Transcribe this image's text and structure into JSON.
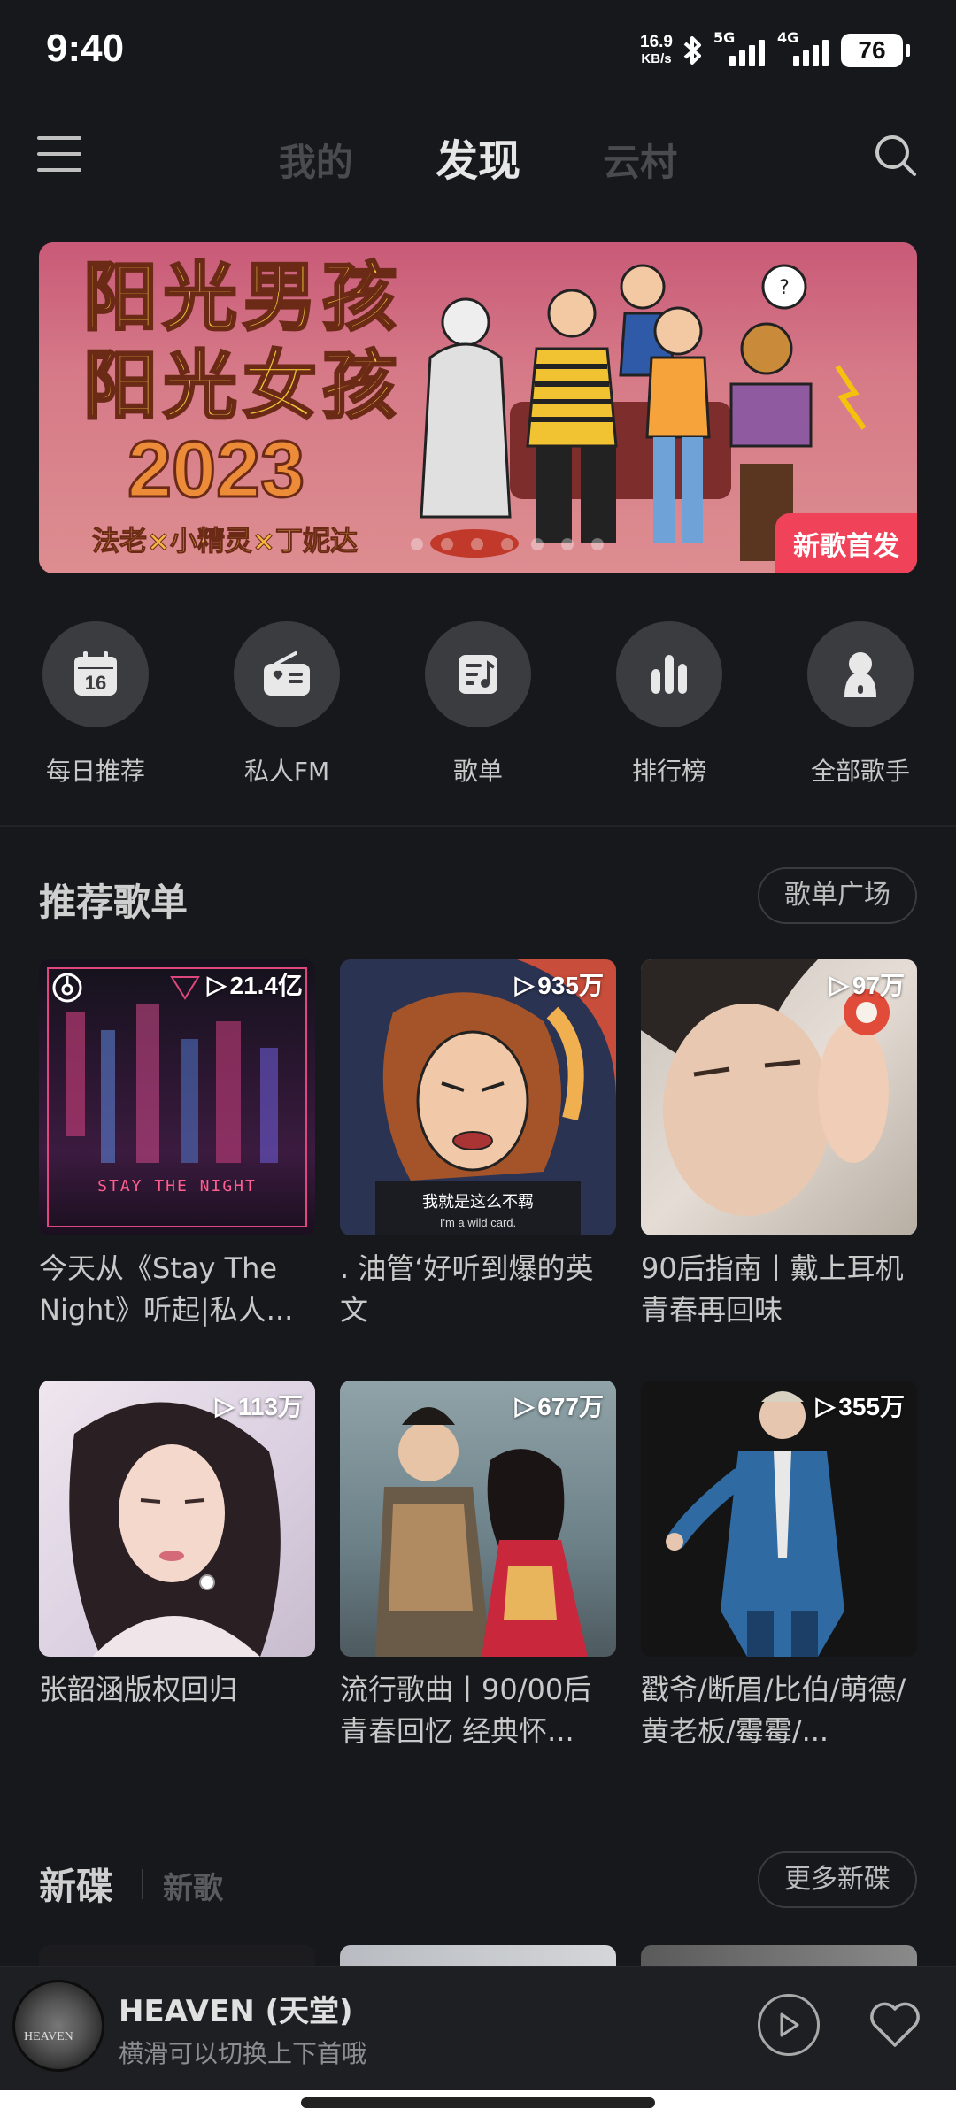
{
  "status": {
    "time": "9:40",
    "net_speed_value": "16.9",
    "net_speed_unit": "KB/s",
    "sim1": "5G",
    "sim2": "4G",
    "battery": "76"
  },
  "nav": {
    "tabs": [
      {
        "label": "我的"
      },
      {
        "label": "发现"
      },
      {
        "label": "云村"
      }
    ],
    "active_tab": "发现"
  },
  "banner": {
    "title_line1": "阳光男孩",
    "title_line2": "阳光女孩",
    "year": "2023",
    "artists": "法老×小精灵×丁妮达",
    "tag": "新歌首发",
    "colors": {
      "bg": "#d67a88",
      "tag": "#f0435a",
      "title": "#f2c53a"
    }
  },
  "shortcuts": [
    {
      "label": "每日推荐",
      "icon": "calendar-icon",
      "number": "16"
    },
    {
      "label": "私人FM",
      "icon": "radio-icon"
    },
    {
      "label": "歌单",
      "icon": "playlist-icon"
    },
    {
      "label": "排行榜",
      "icon": "chart-bars-icon"
    },
    {
      "label": "全部歌手",
      "icon": "singer-icon"
    }
  ],
  "recommended": {
    "title": "推荐歌单",
    "button": "歌单广场",
    "playlists": [
      {
        "count": "21.4亿",
        "name": "今天从《Stay The Night》听起|私人...",
        "cover_text": "STAY THE NIGHT"
      },
      {
        "count": "935万",
        "name": ". 油管‘好听到爆的英文",
        "cover_text": "我就是这么不羁",
        "cover_subtext": "I'm a wild card."
      },
      {
        "count": "97万",
        "name": "90后指南丨戴上耳机青春再回味"
      },
      {
        "count": "113万",
        "name": "张韶涵版权回归"
      },
      {
        "count": "677万",
        "name": "流行歌曲丨90/00后青春回忆 经典怀..."
      },
      {
        "count": "355万",
        "name": "戳爷/断眉/比伯/萌德/黄老板/霉霉/..."
      }
    ]
  },
  "new_releases": {
    "tab_active": "新碟",
    "tab_inactive": "新歌",
    "button": "更多新碟"
  },
  "player": {
    "title": "HEAVEN (天堂)",
    "subtitle": "横滑可以切换上下首哦",
    "disc_text": "HEAVEN"
  }
}
